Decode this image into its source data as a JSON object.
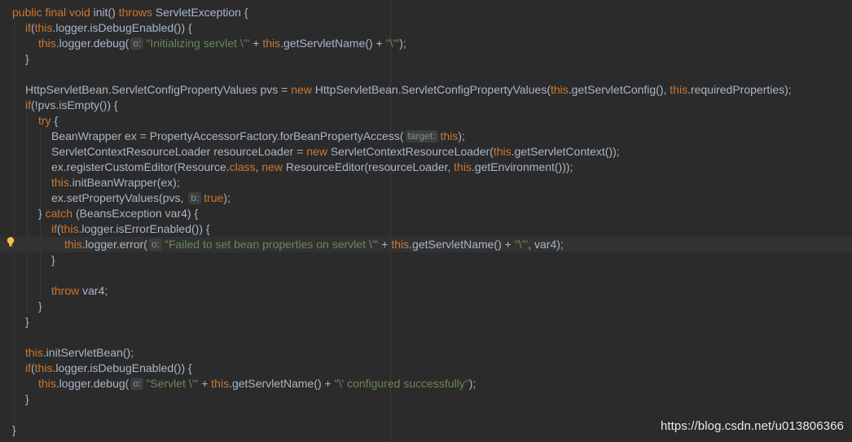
{
  "editor": {
    "lines": [
      {
        "indent": 0,
        "caret": false,
        "segs": [
          [
            "kw",
            "public final void "
          ],
          [
            "t",
            "init() "
          ],
          [
            "kw",
            "throws "
          ],
          [
            "t",
            "ServletException {"
          ]
        ]
      },
      {
        "indent": 1,
        "caret": false,
        "segs": [
          [
            "kw",
            "if"
          ],
          [
            "t",
            "("
          ],
          [
            "kw",
            "this"
          ],
          [
            "t",
            ".logger.isDebugEnabled()) {"
          ]
        ]
      },
      {
        "indent": 2,
        "caret": false,
        "segs": [
          [
            "kw",
            "this"
          ],
          [
            "t",
            ".logger.debug("
          ],
          [
            "hint",
            "o:"
          ],
          [
            "str",
            "\"Initializing servlet \\'\""
          ],
          [
            "t",
            " + "
          ],
          [
            "kw",
            "this"
          ],
          [
            "t",
            ".getServletName() + "
          ],
          [
            "str",
            "\"\\'\""
          ],
          [
            "t",
            ");"
          ]
        ]
      },
      {
        "indent": 1,
        "caret": false,
        "segs": [
          [
            "t",
            "}"
          ]
        ]
      },
      {
        "indent": 0,
        "caret": false,
        "segs": []
      },
      {
        "indent": 1,
        "caret": false,
        "segs": [
          [
            "t",
            "HttpServletBean.ServletConfigPropertyValues pvs = "
          ],
          [
            "kw",
            "new "
          ],
          [
            "t",
            "HttpServletBean.ServletConfigPropertyValues("
          ],
          [
            "kw",
            "this"
          ],
          [
            "t",
            ".getServletConfig(), "
          ],
          [
            "kw",
            "this"
          ],
          [
            "t",
            ".requiredProperties);"
          ]
        ]
      },
      {
        "indent": 1,
        "caret": false,
        "segs": [
          [
            "kw",
            "if"
          ],
          [
            "t",
            "(!pvs.isEmpty()) {"
          ]
        ]
      },
      {
        "indent": 2,
        "caret": false,
        "segs": [
          [
            "kw",
            "try "
          ],
          [
            "t",
            "{"
          ]
        ]
      },
      {
        "indent": 3,
        "caret": false,
        "segs": [
          [
            "t",
            "BeanWrapper ex = PropertyAccessorFactory.forBeanPropertyAccess("
          ],
          [
            "hint",
            "target:"
          ],
          [
            "kw",
            "this"
          ],
          [
            "t",
            ");"
          ]
        ]
      },
      {
        "indent": 3,
        "caret": false,
        "segs": [
          [
            "t",
            "ServletContextResourceLoader resourceLoader = "
          ],
          [
            "kw",
            "new "
          ],
          [
            "t",
            "ServletContextResourceLoader("
          ],
          [
            "kw",
            "this"
          ],
          [
            "t",
            ".getServletContext());"
          ]
        ]
      },
      {
        "indent": 3,
        "caret": false,
        "segs": [
          [
            "t",
            "ex.registerCustomEditor(Resource."
          ],
          [
            "kw",
            "class"
          ],
          [
            "t",
            ", "
          ],
          [
            "kw",
            "new "
          ],
          [
            "t",
            "ResourceEditor(resourceLoader, "
          ],
          [
            "kw",
            "this"
          ],
          [
            "t",
            ".getEnvironment()));"
          ]
        ]
      },
      {
        "indent": 3,
        "caret": false,
        "segs": [
          [
            "kw",
            "this"
          ],
          [
            "t",
            ".initBeanWrapper(ex);"
          ]
        ]
      },
      {
        "indent": 3,
        "caret": false,
        "segs": [
          [
            "t",
            "ex.setPropertyValues(pvs, "
          ],
          [
            "hint",
            "b:"
          ],
          [
            "kw",
            "true"
          ],
          [
            "t",
            ");"
          ]
        ]
      },
      {
        "indent": 2,
        "caret": false,
        "segs": [
          [
            "t",
            "} "
          ],
          [
            "kw",
            "catch "
          ],
          [
            "t",
            "(BeansException var4) {"
          ]
        ]
      },
      {
        "indent": 3,
        "caret": false,
        "segs": [
          [
            "kw",
            "if"
          ],
          [
            "t",
            "("
          ],
          [
            "kw",
            "this"
          ],
          [
            "t",
            ".logger.isErrorEnabled()) {"
          ]
        ]
      },
      {
        "indent": 4,
        "caret": true,
        "segs": [
          [
            "kw",
            "this"
          ],
          [
            "t",
            ".logger.error("
          ],
          [
            "hint",
            "o:"
          ],
          [
            "str",
            "\"Failed to set bean properties on servlet \\'\""
          ],
          [
            "t",
            " + "
          ],
          [
            "kw",
            "this"
          ],
          [
            "t",
            ".getServletName() + "
          ],
          [
            "str",
            "\"\\'\""
          ],
          [
            "t",
            ", var4);"
          ]
        ]
      },
      {
        "indent": 3,
        "caret": false,
        "segs": [
          [
            "t",
            "}"
          ]
        ]
      },
      {
        "indent": 0,
        "caret": false,
        "segs": []
      },
      {
        "indent": 3,
        "caret": false,
        "segs": [
          [
            "kw",
            "throw "
          ],
          [
            "t",
            "var4;"
          ]
        ]
      },
      {
        "indent": 2,
        "caret": false,
        "segs": [
          [
            "t",
            "}"
          ]
        ]
      },
      {
        "indent": 1,
        "caret": false,
        "segs": [
          [
            "t",
            "}"
          ]
        ]
      },
      {
        "indent": 0,
        "caret": false,
        "segs": []
      },
      {
        "indent": 1,
        "caret": false,
        "segs": [
          [
            "kw",
            "this"
          ],
          [
            "t",
            ".initServletBean();"
          ]
        ]
      },
      {
        "indent": 1,
        "caret": false,
        "segs": [
          [
            "kw",
            "if"
          ],
          [
            "t",
            "("
          ],
          [
            "kw",
            "this"
          ],
          [
            "t",
            ".logger.isDebugEnabled()) {"
          ]
        ]
      },
      {
        "indent": 2,
        "caret": false,
        "segs": [
          [
            "kw",
            "this"
          ],
          [
            "t",
            ".logger.debug("
          ],
          [
            "hint",
            "o:"
          ],
          [
            "str",
            "\"Servlet \\'\""
          ],
          [
            "t",
            " + "
          ],
          [
            "kw",
            "this"
          ],
          [
            "t",
            ".getServletName() + "
          ],
          [
            "str",
            "\"\\' configured successfully\""
          ],
          [
            "t",
            ");"
          ]
        ]
      },
      {
        "indent": 1,
        "caret": false,
        "segs": [
          [
            "t",
            "}"
          ]
        ]
      },
      {
        "indent": 0,
        "caret": false,
        "segs": []
      },
      {
        "indent": 0,
        "caret": false,
        "segs": [
          [
            "t",
            "}"
          ]
        ]
      }
    ]
  },
  "gutter": {
    "intention_icon": "lightbulb-icon"
  },
  "watermark": {
    "text": "https://blog.csdn.net/u013806366"
  },
  "colors": {
    "background": "#2b2b2b",
    "text": "#a9b7c6",
    "keyword": "#cc7832",
    "string": "#6a8759",
    "hint_bg": "#3b3f41",
    "caret_line": "#323232"
  }
}
